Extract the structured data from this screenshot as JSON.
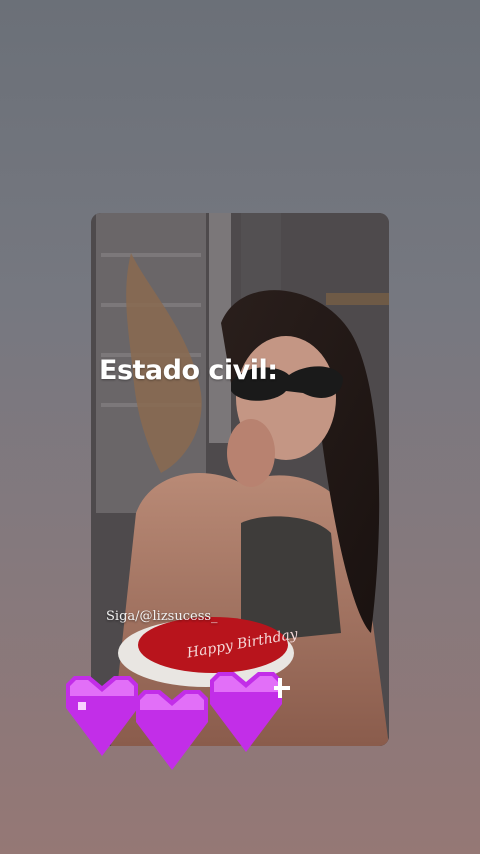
{
  "story": {
    "caption": "Estado civil:",
    "handle": "Siga/@lizsucess_",
    "cake_text": "Happy Birthday"
  },
  "sticker": {
    "name": "pixel-hearts-sticker",
    "count": 3,
    "color": "#c22ee8"
  },
  "colors": {
    "background_top": "#6b7078",
    "background_bottom": "#957875",
    "cake": "#b8141c",
    "heart_primary": "#c22ee8",
    "heart_light": "#f08cff"
  }
}
